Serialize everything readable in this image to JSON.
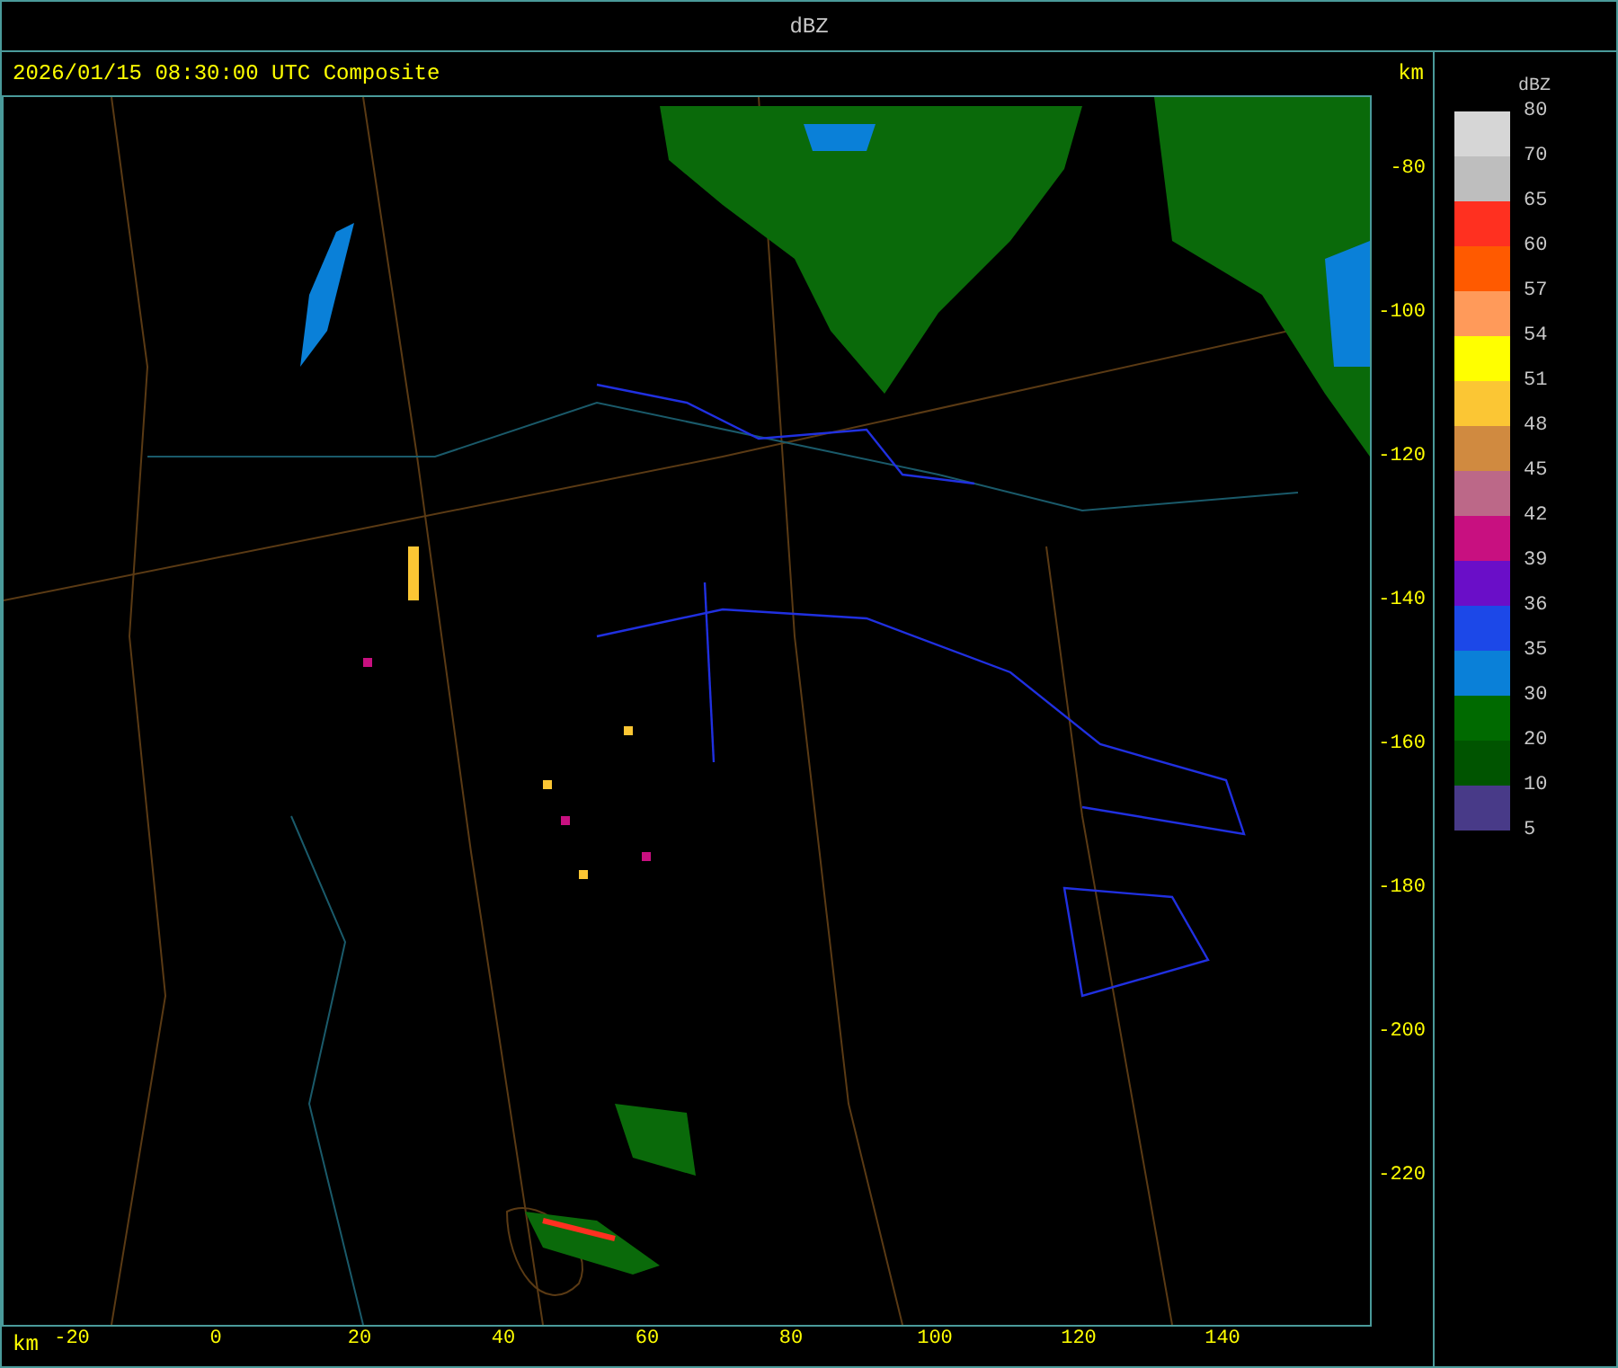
{
  "window": {
    "title": "dBZ"
  },
  "header": {
    "caption": "2026/01/15 08:30:00 UTC Composite",
    "unit": "km"
  },
  "y_axis": {
    "ticks": [
      "-80",
      "-100",
      "-120",
      "-140",
      "-160",
      "-180",
      "-200",
      "-220"
    ]
  },
  "x_axis": {
    "unit": "km",
    "ticks": [
      "-20",
      "0",
      "20",
      "40",
      "60",
      "80",
      "100",
      "120",
      "140"
    ]
  },
  "legend": {
    "title": "dBZ",
    "bands": [
      {
        "label": "80",
        "color": "#d6d6d6"
      },
      {
        "label": "70",
        "color": "#bebebe"
      },
      {
        "label": "65",
        "color": "#ff3020"
      },
      {
        "label": "60",
        "color": "#ff5a00"
      },
      {
        "label": "57",
        "color": "#ff9a5a"
      },
      {
        "label": "54",
        "color": "#ffff00"
      },
      {
        "label": "51",
        "color": "#fbc634"
      },
      {
        "label": "48",
        "color": "#d08a40"
      },
      {
        "label": "45",
        "color": "#bc6888"
      },
      {
        "label": "42",
        "color": "#c81080"
      },
      {
        "label": "39",
        "color": "#6a0ec8"
      },
      {
        "label": "36",
        "color": "#1c48e8"
      },
      {
        "label": "35",
        "color": "#0a80d8"
      },
      {
        "label": "30",
        "color": "#006a00"
      },
      {
        "label": "20",
        "color": "#005400"
      },
      {
        "label": "10",
        "color": "#483a88"
      }
    ],
    "bottom_label": "5"
  }
}
